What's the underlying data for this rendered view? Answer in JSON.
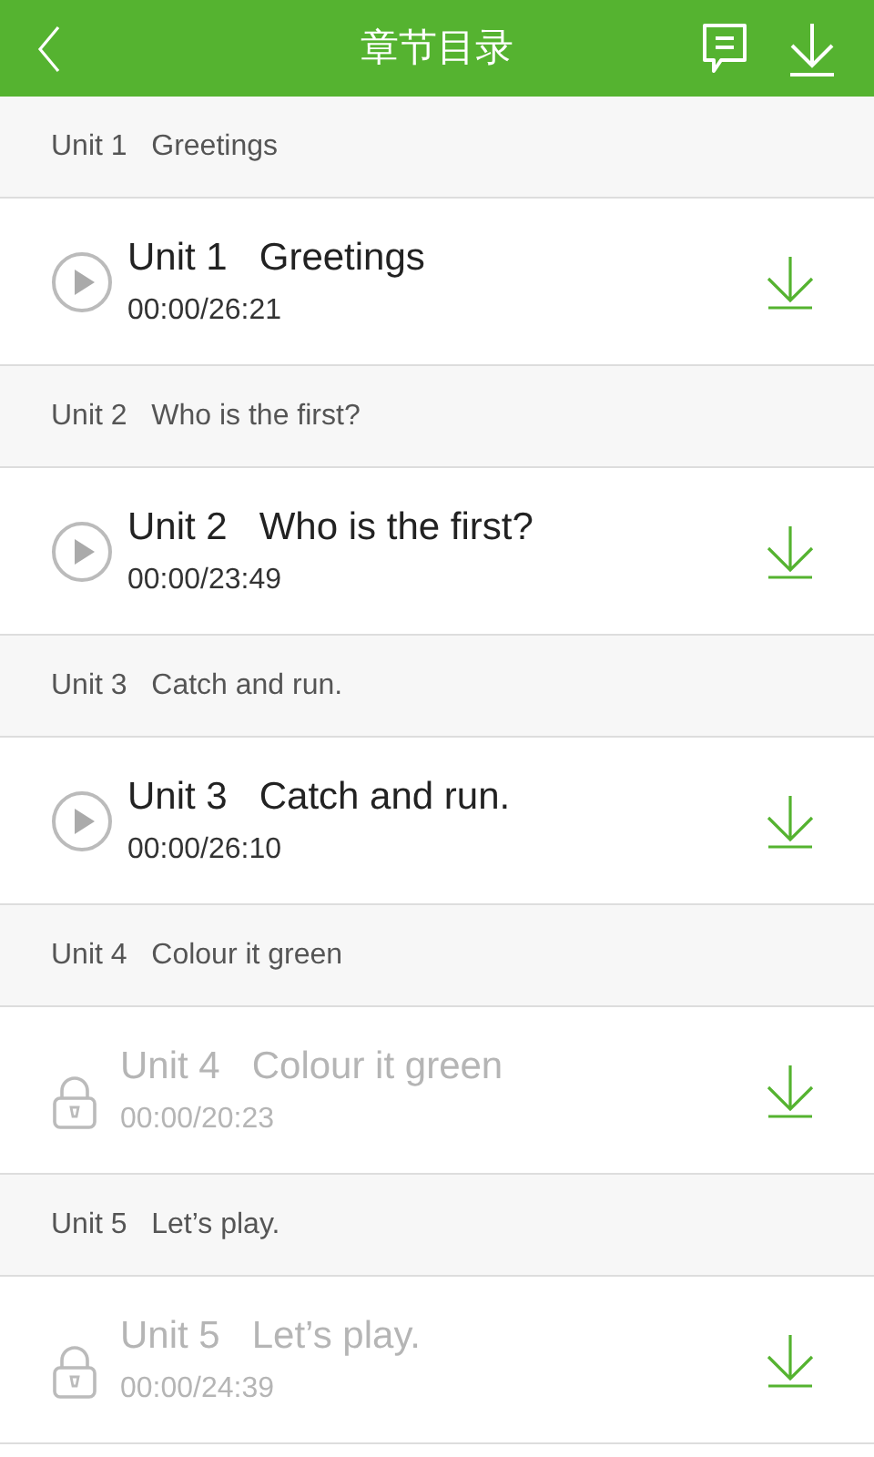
{
  "header": {
    "title": "章节目录"
  },
  "sections": [
    {
      "heading": "Unit 1   Greetings",
      "item": {
        "title": "Unit 1   Greetings",
        "duration": "00:00/26:21",
        "locked": false
      }
    },
    {
      "heading": "Unit 2   Who is the first?",
      "item": {
        "title": "Unit 2   Who is the first?",
        "duration": "00:00/23:49",
        "locked": false
      }
    },
    {
      "heading": "Unit 3   Catch and run.",
      "item": {
        "title": "Unit 3   Catch and run.",
        "duration": "00:00/26:10",
        "locked": false
      }
    },
    {
      "heading": "Unit 4   Colour it green",
      "item": {
        "title": "Unit 4   Colour it green",
        "duration": "00:00/20:23",
        "locked": true
      }
    },
    {
      "heading": "Unit 5   Let’s play.",
      "item": {
        "title": "Unit 5   Let’s play.",
        "duration": "00:00/24:39",
        "locked": true
      }
    }
  ]
}
